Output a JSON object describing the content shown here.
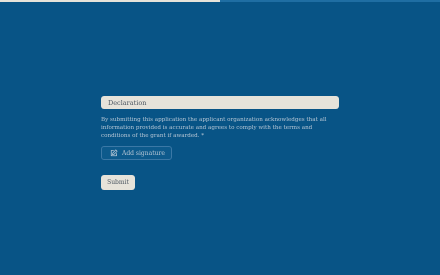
{
  "progress": {
    "fraction": 0.5
  },
  "section": {
    "title": "Declaration"
  },
  "declaration": {
    "text": "By submitting this application the applicant organization acknowledges that all information provided is accurate and agrees to comply with the terms and conditions of the grant if awarded. *"
  },
  "signature": {
    "label": "Add signature",
    "icon": "edit-icon"
  },
  "submit": {
    "label": "Submit"
  },
  "colors": {
    "background": "#085486",
    "panel": "#e6e3da",
    "muted_text": "#b9c8d6"
  }
}
